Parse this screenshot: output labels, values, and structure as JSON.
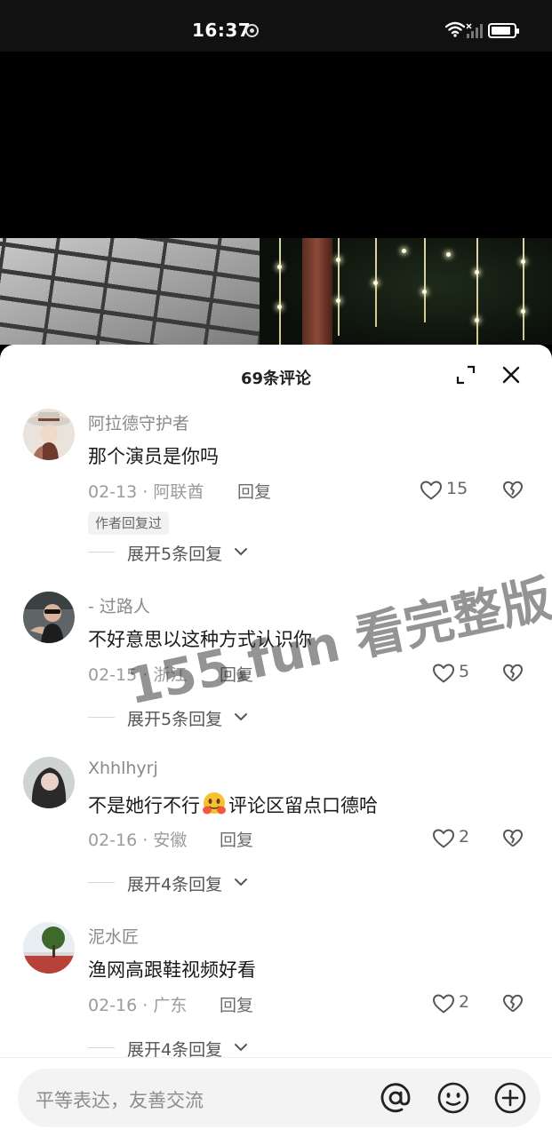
{
  "status_bar": {
    "time": "16:37"
  },
  "comments_panel": {
    "title": "69条评论",
    "icons": {
      "expand": "expand-icon",
      "close": "close-icon"
    }
  },
  "comments": [
    {
      "username": "阿拉德守护者",
      "text": "那个演员是你吗",
      "date": "02-13 · 阿联酋",
      "reply_label": "回复",
      "likes": "15",
      "author_badge": "作者回复过",
      "expand_label": "展开5条回复"
    },
    {
      "username": "- 过路人",
      "text": "不好意思以这种方式认识你",
      "date": "02-15 · 浙江",
      "reply_label": "回复",
      "likes": "5",
      "expand_label": "展开5条回复"
    },
    {
      "username": "Xhhlhyrj",
      "text_before_emoji": "不是她行不行",
      "text_after_emoji": "评论区留点口德哈",
      "date": "02-16 · 安徽",
      "reply_label": "回复",
      "likes": "2",
      "expand_label": "展开4条回复"
    },
    {
      "username": "泥水匠",
      "text": "渔网高跟鞋视频好看",
      "date": "02-16 · 广东",
      "reply_label": "回复",
      "likes": "2",
      "expand_label": "展开4条回复"
    }
  ],
  "watermark": "155.fun 看完整版",
  "input_bar": {
    "placeholder": "平等表达，友善交流",
    "icons": [
      "at-icon",
      "emoji-icon",
      "plus-icon"
    ]
  },
  "colors": {
    "sheet_background": "#ffffff",
    "secondary_text": "#8a8a8a",
    "primary_text": "#1a1a1a",
    "input_background": "#f3f3f3"
  }
}
